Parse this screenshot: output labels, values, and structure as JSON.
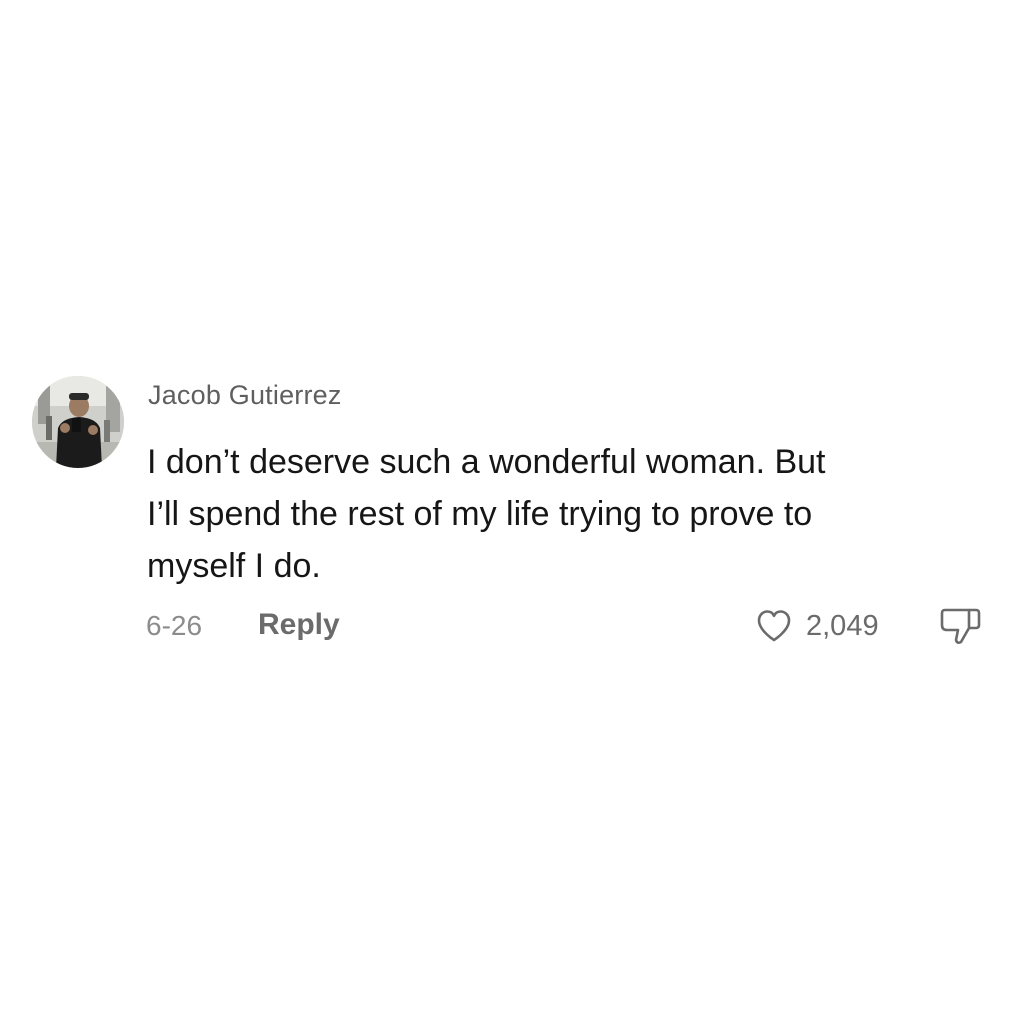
{
  "comment": {
    "avatar_icon": "user-photo-avatar",
    "username": "Jacob Gutierrez",
    "text_lines": [
      "I don’t deserve such a wonderful woman. But",
      "I’ll spend the rest of my life trying to prove to",
      "myself I do."
    ],
    "date": "6-26",
    "reply_label": "Reply",
    "like_icon": "heart-outline-icon",
    "like_count": "2,049",
    "dislike_icon": "thumbs-down-icon"
  }
}
